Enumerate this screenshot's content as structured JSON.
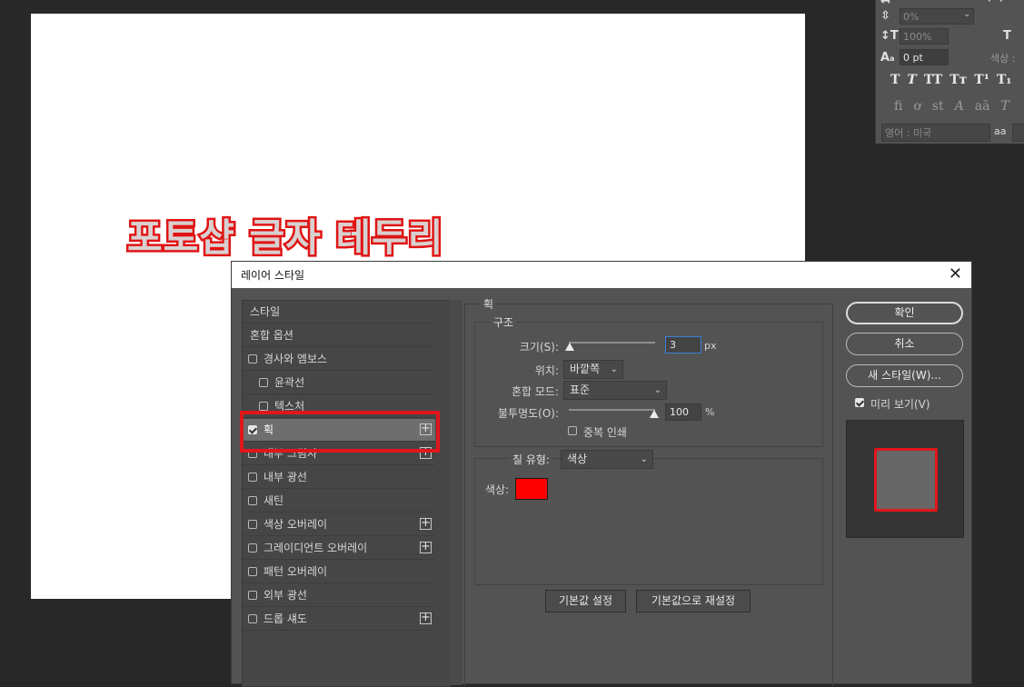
{
  "canvas": {
    "text": "포토샵 글자 테두리"
  },
  "character_panel": {
    "tracking_value": "0%",
    "vertical_scale": "100%",
    "baseline_shift": "0 pt",
    "color_label": "색상 :",
    "language": "영어 : 미국",
    "aa_label": "aa",
    "typo_buttons": [
      "T",
      "T",
      "TT",
      "Tт",
      "T¹",
      "T₁"
    ],
    "opentype_buttons": [
      "fi",
      "ơ",
      "st",
      "A",
      "aā",
      "T"
    ]
  },
  "dialog": {
    "title": "레이어 스타일",
    "close": "✕",
    "style_list": [
      {
        "label": "스타일",
        "checkbox": false,
        "checked": false,
        "plus": false,
        "indent": false
      },
      {
        "label": "혼합 옵션",
        "checkbox": false,
        "checked": false,
        "plus": false,
        "indent": false
      },
      {
        "label": "경사와 엠보스",
        "checkbox": true,
        "checked": false,
        "plus": false,
        "indent": false
      },
      {
        "label": "윤곽선",
        "checkbox": true,
        "checked": false,
        "plus": false,
        "indent": true
      },
      {
        "label": "텍스처",
        "checkbox": true,
        "checked": false,
        "plus": false,
        "indent": true
      },
      {
        "label": "획",
        "checkbox": true,
        "checked": true,
        "plus": true,
        "indent": false
      },
      {
        "label": "내부 그림자",
        "checkbox": true,
        "checked": false,
        "plus": true,
        "indent": false
      },
      {
        "label": "내부 광선",
        "checkbox": true,
        "checked": false,
        "plus": false,
        "indent": false
      },
      {
        "label": "새틴",
        "checkbox": true,
        "checked": false,
        "plus": false,
        "indent": false
      },
      {
        "label": "색상 오버레이",
        "checkbox": true,
        "checked": false,
        "plus": true,
        "indent": false
      },
      {
        "label": "그레이디언트 오버레이",
        "checkbox": true,
        "checked": false,
        "plus": true,
        "indent": false
      },
      {
        "label": "패턴 오버레이",
        "checkbox": true,
        "checked": false,
        "plus": false,
        "indent": false
      },
      {
        "label": "외부 광선",
        "checkbox": true,
        "checked": false,
        "plus": false,
        "indent": false
      },
      {
        "label": "드롭 섀도",
        "checkbox": true,
        "checked": false,
        "plus": true,
        "indent": false
      }
    ],
    "stroke": {
      "group_title": "획",
      "structure_title": "구조",
      "size_label": "크기(S):",
      "size_value": "3",
      "size_unit": "px",
      "position_label": "위치:",
      "position_value": "바깥쪽",
      "blend_label": "혼합 모드:",
      "blend_value": "표준",
      "opacity_label": "불투명도(O):",
      "opacity_value": "100",
      "opacity_unit": "%",
      "overprint_label": "중복 인쇄",
      "fill_type_label": "칠 유형:",
      "fill_type_value": "색상",
      "color_label": "색상:",
      "color_value": "#ff0000",
      "default_button": "기본값 설정",
      "reset_button": "기본값으로 재설정"
    },
    "buttons": {
      "ok": "확인",
      "cancel": "취소",
      "new_style": "새 스타일(W)...",
      "preview_label": "미리 보기(V)"
    }
  }
}
